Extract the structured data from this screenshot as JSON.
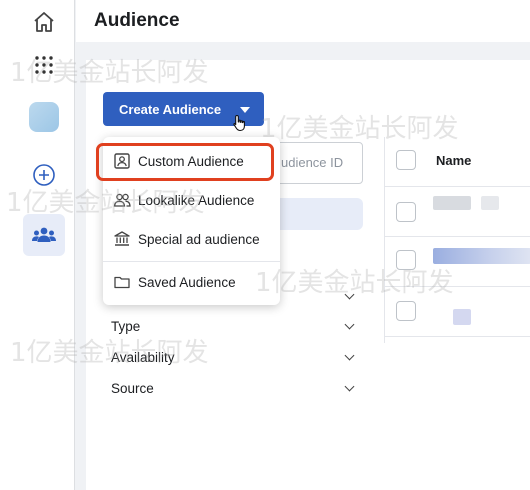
{
  "header": {
    "title": "Audience"
  },
  "rail": {
    "icons": [
      "home-icon",
      "apps-grid-icon",
      "account-thumbnail",
      "add-circle-icon",
      "audience-people-icon"
    ]
  },
  "toolbar": {
    "create_label": "Create Audience"
  },
  "search": {
    "placeholder": "udience ID"
  },
  "dropdown": {
    "items": [
      {
        "label": "Custom Audience",
        "icon": "custom-audience-icon"
      },
      {
        "label": "Lookalike Audience",
        "icon": "lookalike-icon"
      },
      {
        "label": "Special ad audience",
        "icon": "building-icon"
      },
      {
        "label": "Saved Audience",
        "icon": "folder-icon"
      }
    ]
  },
  "filters": [
    {
      "label": "Type"
    },
    {
      "label": "Availability"
    },
    {
      "label": "Source"
    }
  ],
  "table": {
    "header": "Name"
  },
  "watermark": "1亿美金站长阿发",
  "colors": {
    "accent": "#2f5fbf",
    "highlight": "#e0401f",
    "rail_active": "#e7ecf8"
  }
}
